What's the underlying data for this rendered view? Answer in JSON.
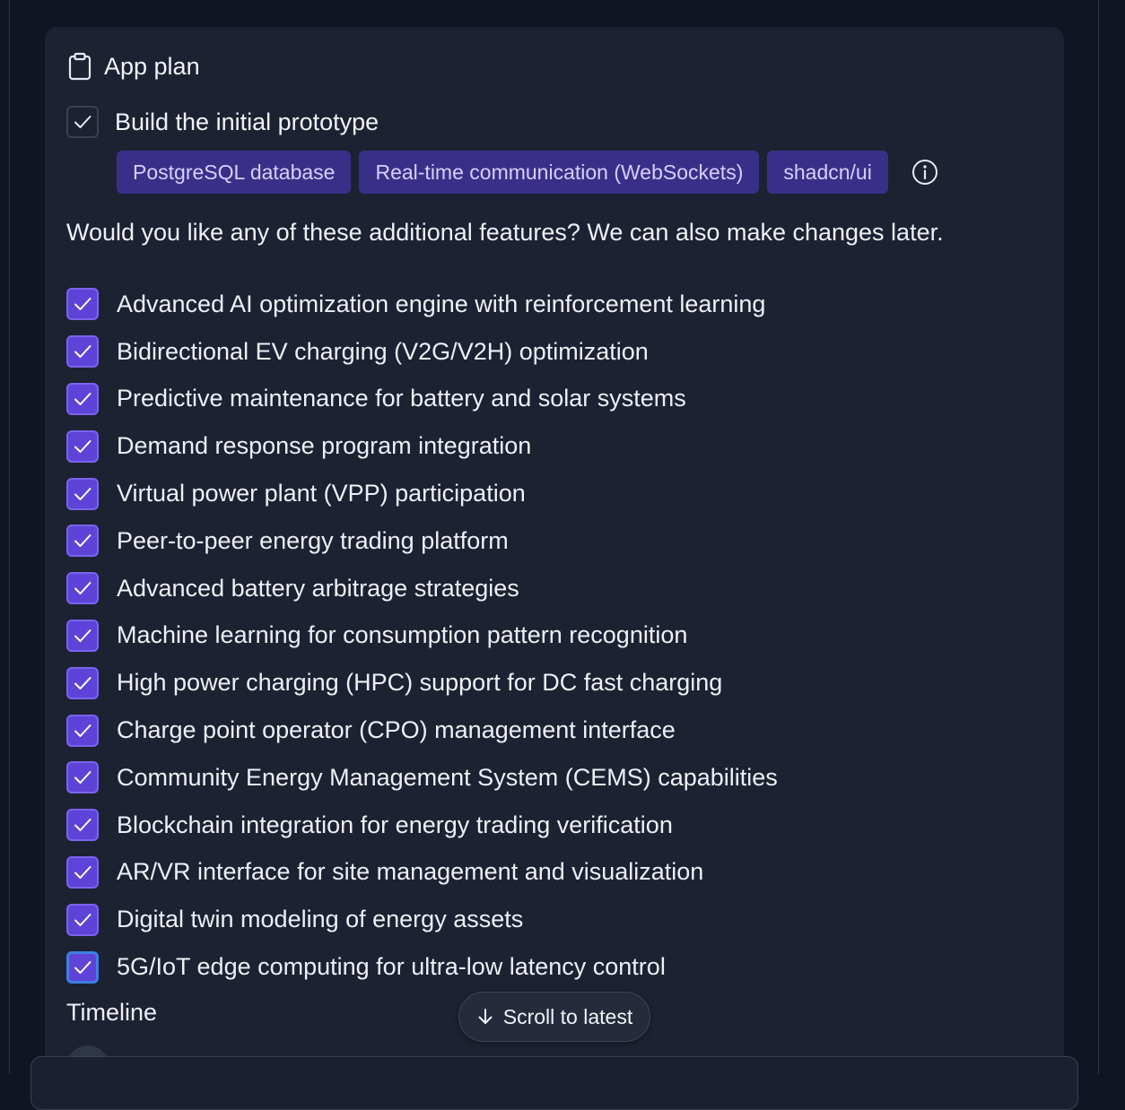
{
  "header": {
    "title": "App plan",
    "icon": "clipboard-icon"
  },
  "prototype": {
    "label": "Build the initial prototype",
    "checked": true,
    "tags": [
      "PostgreSQL database",
      "Real-time communication (WebSockets)",
      "shadcn/ui"
    ]
  },
  "question": "Would you like any of these additional features? We can also make changes later.",
  "features": [
    "Advanced AI optimization engine with reinforcement learning",
    "Bidirectional EV charging (V2G/V2H) optimization",
    "Predictive maintenance for battery and solar systems",
    "Demand response program integration",
    "Virtual power plant (VPP) participation",
    "Peer-to-peer energy trading platform",
    "Advanced battery arbitrage strategies",
    "Machine learning for consumption pattern recognition",
    "High power charging (HPC) support for DC fast charging",
    "Charge point operator (CPO) management interface",
    "Community Energy Management System (CEMS) capabilities",
    "Blockchain integration for energy trading verification",
    "AR/VR interface for site management and visualization",
    "Digital twin modeling of energy assets",
    "5G/IoT edge computing for ultra-low latency control"
  ],
  "timeline": {
    "title": "Timeline"
  },
  "scroll_button": {
    "label": "Scroll to latest",
    "icon": "arrow-down-icon"
  },
  "colors": {
    "background": "#0f1522",
    "card": "#1d2232",
    "accent": "#5e43d8",
    "tag_bg": "#3a2f88",
    "tag_text": "#d7cffd",
    "focus_ring": "#3f7fe6"
  }
}
